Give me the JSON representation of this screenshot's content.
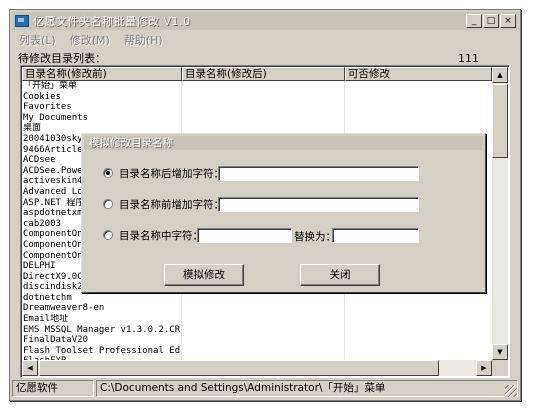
{
  "window": {
    "title": "亿愿文件夹名称批量修改 V1.0",
    "controls": {
      "minimize": "_",
      "maximize": "□",
      "close": "×"
    }
  },
  "menu": [
    {
      "label": "列表(L)"
    },
    {
      "label": "修改(M)"
    },
    {
      "label": "帮助(H)"
    }
  ],
  "list": {
    "label": "待修改目录列表：",
    "count": "111",
    "columns": [
      "目录名称(修改前)",
      "目录名称(修改后)",
      "可否修改"
    ],
    "rows": [
      "「开始」菜单",
      "Cookies",
      "Favorites",
      "My Documents",
      "桌面",
      "20041030skyfw",
      "9466Articlevl",
      "ACDsee",
      "ACDSee.PowerP",
      "activeskin4",
      "Advanced Log",
      "ASP.NET 程序ᴵ",
      "aspdotnetxml",
      "cab2003",
      "ComponentOne.",
      "ComponentOne.",
      "ComponentOne.",
      "DELPHI",
      "DirectX9.0C",
      "discindisk2_c",
      "dotnetchm",
      "Dreamweaver8-en",
      "Email地址",
      "EMS MSSQL Manager v1.3.0.2.CR",
      "FinalDataV20",
      "Flash Toolset Professional Ed...",
      "FlashFXP"
    ]
  },
  "status": {
    "left": "亿愿软件",
    "path": "C:\\Documents and Settings\\Administrator\\「开始」菜单"
  },
  "dialog": {
    "title": "模拟修改目录名称",
    "option1": "目录名称后增加字符：",
    "option2": "目录名称前增加字符：",
    "option3": "目录名称中字符：",
    "replace_with": "替换为：",
    "simulate_button": "模拟修改",
    "close_button": "关闭",
    "option1_value": "",
    "option2_value": "",
    "option3_value": "",
    "replace_value": ""
  }
}
